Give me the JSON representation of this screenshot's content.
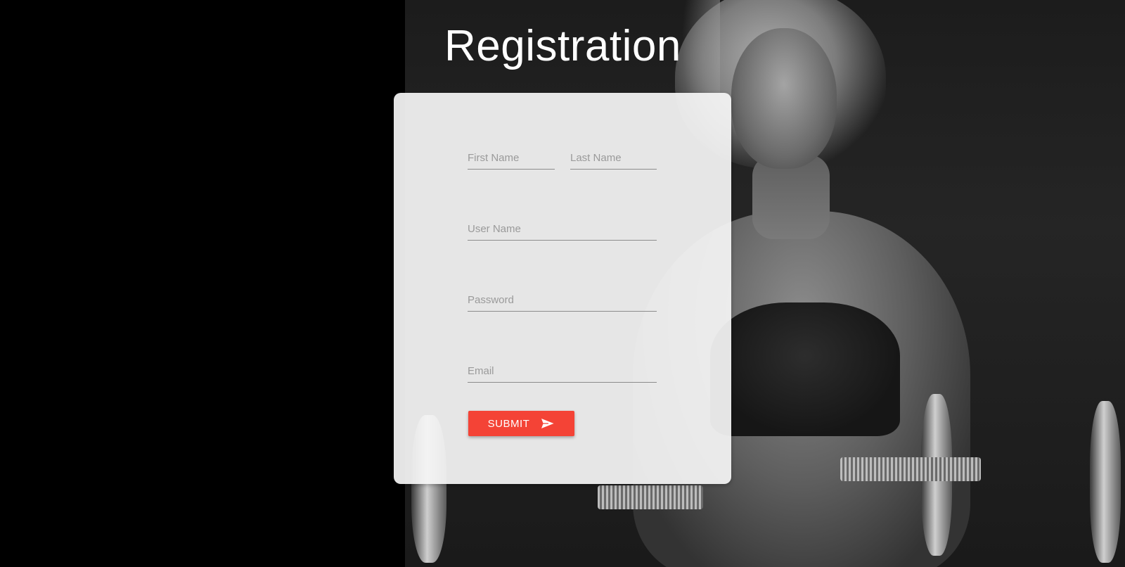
{
  "page": {
    "title": "Registration"
  },
  "form": {
    "first_name": {
      "placeholder": "First Name",
      "value": ""
    },
    "last_name": {
      "placeholder": "Last Name",
      "value": ""
    },
    "user_name": {
      "placeholder": "User Name",
      "value": ""
    },
    "password": {
      "placeholder": "Password",
      "value": ""
    },
    "email": {
      "placeholder": "Email",
      "value": ""
    },
    "submit": {
      "label": "SUBMIT",
      "icon": "send-icon"
    }
  },
  "theme": {
    "accent": "#f44336",
    "card_background": "#f5f5f5",
    "page_background": "#000000",
    "title_color": "#ffffff"
  }
}
